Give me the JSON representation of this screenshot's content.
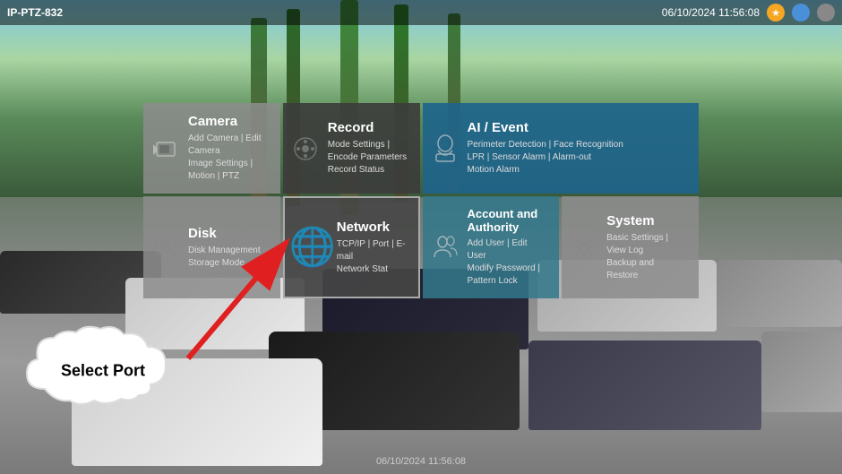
{
  "topbar": {
    "device_id": "IP-PTZ-832",
    "timestamp": "06/10/2024  11:56:08",
    "icons": {
      "star": "★",
      "dot_blue": "●",
      "dot_gray": "●"
    }
  },
  "menu": {
    "items": [
      {
        "id": "camera",
        "title": "Camera",
        "subtitle": "Add Camera | Edit Camera\nImage Settings | Motion | PTZ",
        "icon": "▶"
      },
      {
        "id": "record",
        "title": "Record",
        "subtitle": "Mode Settings | Encode Parameters\nRecord Status",
        "icon": "⏺"
      },
      {
        "id": "ai-event",
        "title": "AI / Event",
        "subtitle": "Perimeter Detection | Face Recognition\nLPR | Sensor Alarm | Alarm-out\nMotion Alarm",
        "icon": "👤"
      },
      {
        "id": "disk",
        "title": "Disk",
        "subtitle": "Disk Management\nStorage Mode",
        "icon": "⚙"
      },
      {
        "id": "network",
        "title": "Network",
        "subtitle": "TCP/IP | Port | E-mail\nNetwork Stat",
        "icon": "🌐"
      },
      {
        "id": "account",
        "title": "Account and Authority",
        "subtitle": "Add User | Edit User\nModify Password | Pattern Lock",
        "icon": "👥"
      },
      {
        "id": "system",
        "title": "System",
        "subtitle": "Basic Settings | View Log\nBackup and Restore",
        "icon": "⚙"
      }
    ]
  },
  "callout": {
    "text": "Select Port"
  },
  "bottom_timestamp": "06/10/2024 11:56:08"
}
